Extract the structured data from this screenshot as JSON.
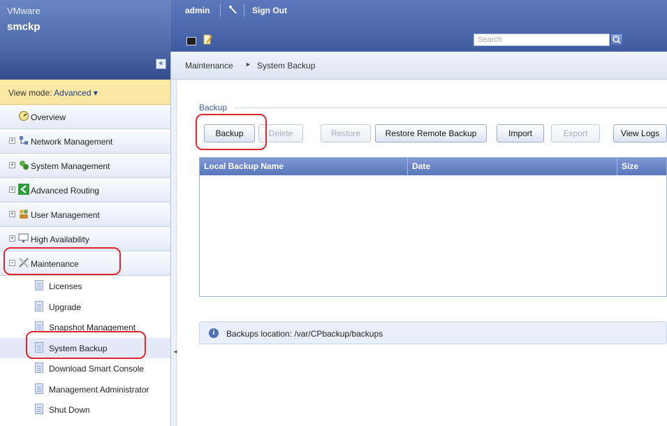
{
  "header": {
    "vendor": "VMware",
    "hostname": "smckp",
    "user": "admin",
    "sign_out": "Sign Out",
    "search_placeholder": "Search"
  },
  "sidebar": {
    "collapse_glyph": "«",
    "view_mode_label": "View mode:",
    "view_mode_value": "Advanced ▾",
    "items": [
      {
        "label": "Overview",
        "icon": "overview-icon"
      },
      {
        "label": "Network Management",
        "icon": "network-icon"
      },
      {
        "label": "System Management",
        "icon": "system-icon"
      },
      {
        "label": "Advanced Routing",
        "icon": "routing-icon"
      },
      {
        "label": "User Management",
        "icon": "users-icon"
      },
      {
        "label": "High Availability",
        "icon": "ha-icon"
      },
      {
        "label": "Maintenance",
        "icon": "maintenance-icon"
      }
    ],
    "maintenance_sub": [
      "Licenses",
      "Upgrade",
      "Snapshot Management",
      "System Backup",
      "Download Smart Console",
      "Management Administrator",
      "Shut Down"
    ],
    "selected_sub": "System Backup"
  },
  "breadcrumb": {
    "parent": "Maintenance",
    "current": "System Backup"
  },
  "backup": {
    "section_label": "Backup",
    "buttons": {
      "backup": "Backup",
      "delete": "Delete",
      "restore": "Restore",
      "restore_remote": "Restore Remote Backup",
      "import": "Import",
      "export": "Export",
      "view_logs": "View Logs"
    },
    "table": {
      "columns": [
        "Local Backup Name",
        "Date",
        "Size"
      ],
      "rows": []
    },
    "info": "Backups location: /var/CPbackup/backups"
  },
  "colors": {
    "header": "#4c67a8",
    "highlight": "#e0262b",
    "view_mode_bg": "#fbe8a3"
  }
}
